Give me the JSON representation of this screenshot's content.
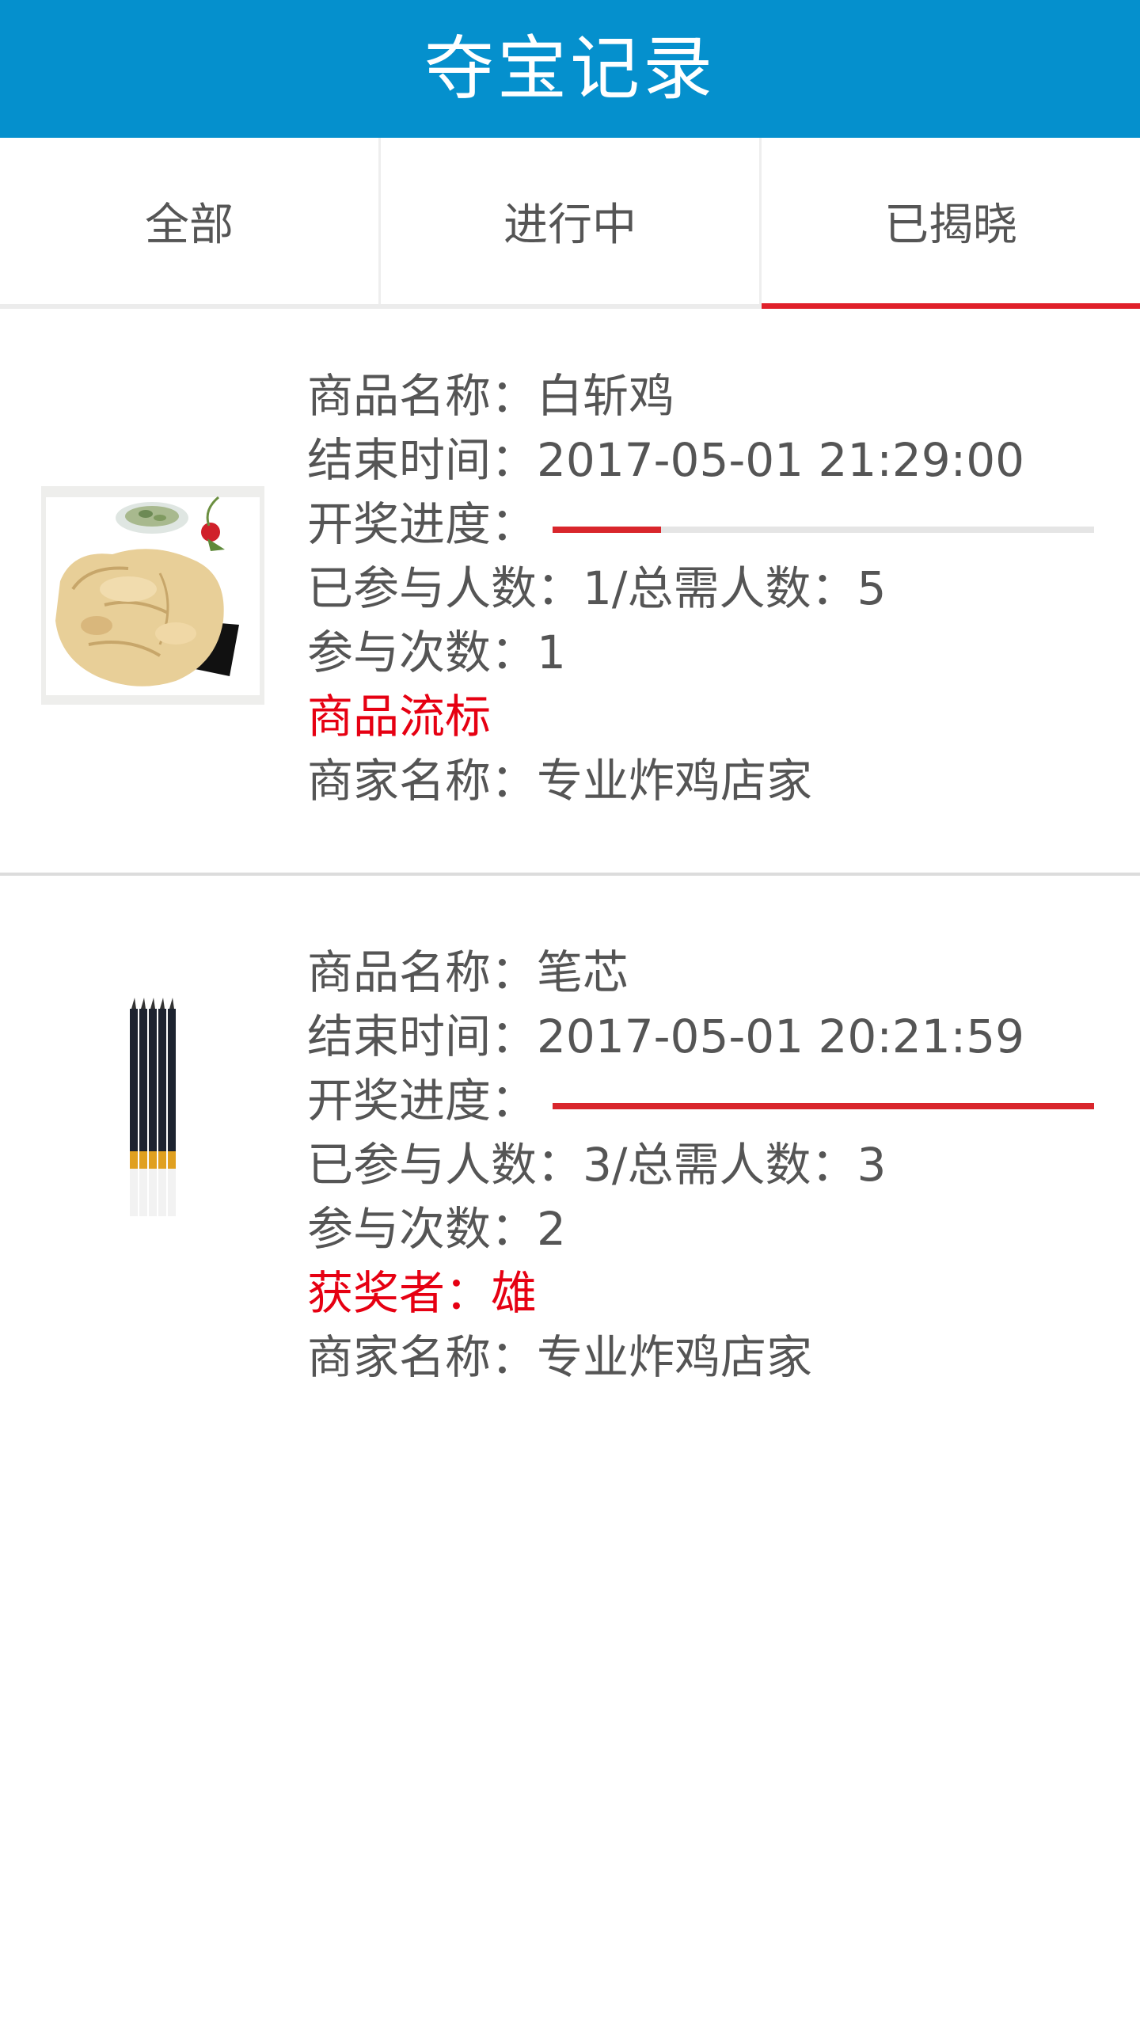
{
  "header": {
    "title": "夺宝记录"
  },
  "tabs": [
    {
      "label": "全部"
    },
    {
      "label": "进行中"
    },
    {
      "label": "已揭晓",
      "active": true
    }
  ],
  "colors": {
    "header_bg": "#0590cd",
    "accent": "#e0202a",
    "text": "#555555",
    "highlight": "#e60012"
  },
  "records": [
    {
      "name_label": "商品名称：",
      "name": "白斩鸡",
      "end_time_label": "结束时间：",
      "end_time": "2017-05-01 21:29:00",
      "progress_label": "开奖进度：",
      "progress": 0.2,
      "participants_text": "已参与人数：1/总需人数：5",
      "times_text": "参与次数：1",
      "status_text": "商品流标",
      "merchant_text": "商家名称：专业炸鸡店家",
      "image_icon": "chicken-dish-image"
    },
    {
      "name_label": "商品名称：",
      "name": "笔芯",
      "end_time_label": "结束时间：",
      "end_time": "2017-05-01 20:21:59",
      "progress_label": "开奖进度：",
      "progress": 1.0,
      "participants_text": "已参与人数：3/总需人数：3",
      "times_text": "参与次数：2",
      "status_text": "获奖者：雄",
      "merchant_text": "商家名称：专业炸鸡店家",
      "image_icon": "pen-refill-image"
    }
  ]
}
